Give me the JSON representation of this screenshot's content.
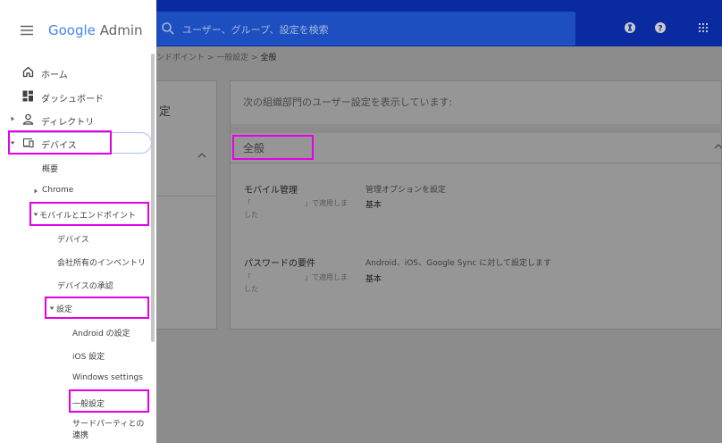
{
  "header": {
    "search_placeholder": "ユーザー、グループ、設定を検索"
  },
  "brand": {
    "google": "Google",
    "admin": "Admin"
  },
  "breadcrumb": {
    "prefix": "ンドポイント > 一般設定 >",
    "current": "全般"
  },
  "left_card": {
    "title": "定"
  },
  "main": {
    "info": "次の組織部門のユーザー設定を表示しています:",
    "section_title": "全般",
    "settings": [
      {
        "label": "モバイル管理",
        "value": "管理オプションを設定",
        "sub_left": "「",
        "sub_mid": "」で適用しま",
        "sub_end": "した",
        "base": "基本"
      },
      {
        "label": "パスワードの要件",
        "value": "Android、iOS、Google Sync に対して設定します",
        "sub_left": "「",
        "sub_mid": "」で適用しま",
        "sub_end": "した",
        "base": "基本"
      }
    ]
  },
  "nav": {
    "home": "ホーム",
    "dashboard": "ダッシュボード",
    "directory": "ディレクトリ",
    "devices": "デバイス",
    "overview": "概要",
    "chrome": "Chrome",
    "mobile_endpoints": "モバイルとエンドポイント",
    "mobile_devices": "デバイス",
    "company_inventory": "会社所有のインベントリ",
    "device_approvals": "デバイスの承認",
    "settings": "設定",
    "android_settings": "Android の設定",
    "ios_settings": "iOS 設定",
    "windows_settings": "Windows settings",
    "general_settings": "一般設定",
    "third_party_1": "サードパーティとの",
    "third_party_2": "連携"
  },
  "colors": {
    "header_bg": "#0a2ba0",
    "highlight": "#e600e6",
    "overlay": "#8c8c8c"
  }
}
